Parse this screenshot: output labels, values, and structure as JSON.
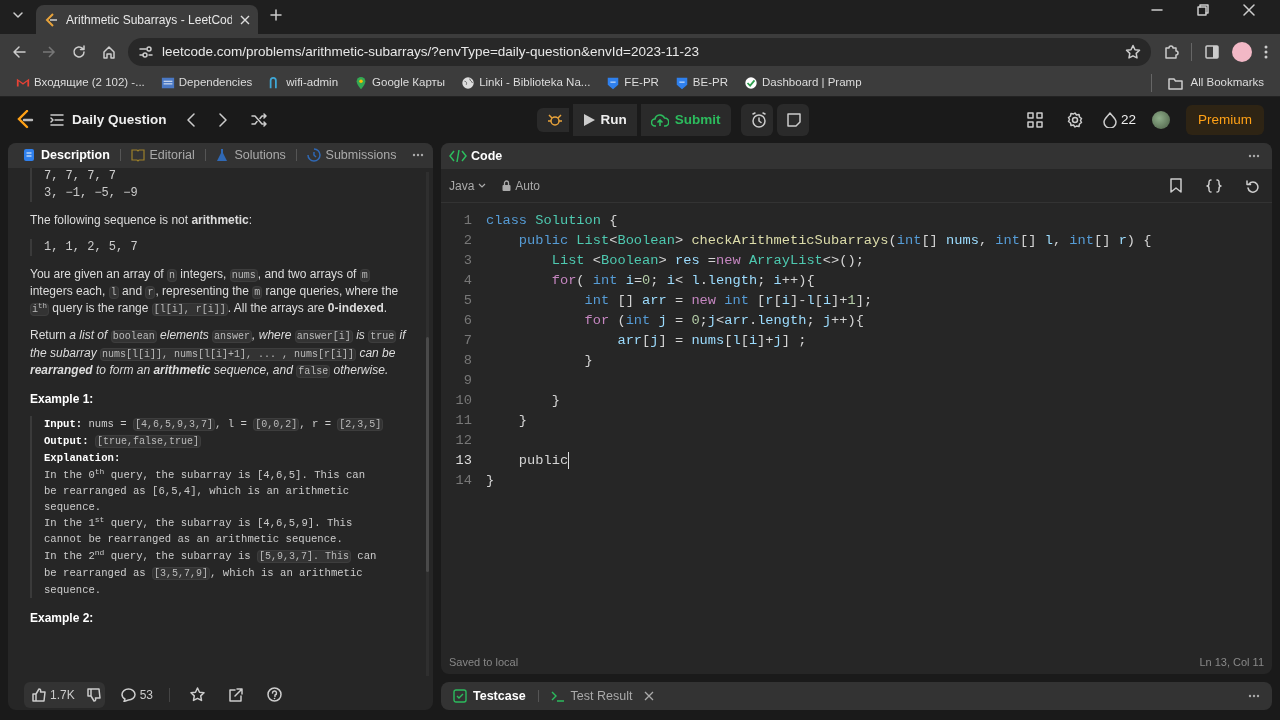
{
  "browser": {
    "tab_title": "Arithmetic Subarrays - LeetCod",
    "url": "leetcode.com/problems/arithmetic-subarrays/?envType=daily-question&envId=2023-11-23",
    "bookmarks": [
      {
        "label": "Входящие (2 102) -...",
        "kind": "mail"
      },
      {
        "label": "Dependencies",
        "kind": "page"
      },
      {
        "label": "wifi-admin",
        "kind": "fork"
      },
      {
        "label": "Google Карты",
        "kind": "pin"
      },
      {
        "label": "Linki - Biblioteka Na...",
        "kind": "globe"
      },
      {
        "label": "FE-PR",
        "kind": "shield"
      },
      {
        "label": "BE-PR",
        "kind": "shield"
      },
      {
        "label": "Dashboard | Pramp",
        "kind": "check"
      }
    ],
    "all_bookmarks": "All Bookmarks"
  },
  "nav": {
    "title": "Daily Question",
    "run": "Run",
    "submit": "Submit",
    "streak": "22",
    "premium": "Premium"
  },
  "tabs": [
    {
      "label": "Description",
      "kind": "doc",
      "selected": true
    },
    {
      "label": "Editorial",
      "kind": "book",
      "selected": false
    },
    {
      "label": "Solutions",
      "kind": "flask",
      "selected": false
    },
    {
      "label": "Submissions",
      "kind": "history",
      "selected": false
    }
  ],
  "description": [
    {
      "kind": "pre",
      "lines": [
        "7, 7, 7, 7",
        "3, −1, −5, −9"
      ]
    },
    {
      "kind": "para",
      "segments": [
        {
          "kind": "text",
          "text": "The following sequence is not **arithmetic**:"
        }
      ]
    },
    {
      "kind": "pre",
      "lines": [
        "1, 1, 2, 5, 7"
      ]
    },
    {
      "kind": "para",
      "segments": [
        {
          "kind": "text",
          "text": "You are given an array of "
        },
        {
          "kind": "code",
          "text": "n"
        },
        {
          "kind": "text",
          "text": " integers, "
        },
        {
          "kind": "code",
          "text": "nums"
        },
        {
          "kind": "text",
          "text": ", and two arrays of "
        },
        {
          "kind": "code",
          "text": "m"
        },
        {
          "kind": "text",
          "text": " integers each, "
        },
        {
          "kind": "code",
          "text": "l"
        },
        {
          "kind": "text",
          "text": " and "
        },
        {
          "kind": "code",
          "text": "r"
        },
        {
          "kind": "text",
          "text": ", representing the "
        },
        {
          "kind": "code",
          "text": "m"
        },
        {
          "kind": "text",
          "text": " range queries, where the "
        },
        {
          "kind": "code",
          "text": "i$^{th}$"
        },
        {
          "kind": "text",
          "text": " query is the range "
        },
        {
          "kind": "code",
          "text": "[l[i], r[i]]"
        },
        {
          "kind": "text",
          "text": ". All the arrays are **0-indexed**."
        }
      ]
    },
    {
      "kind": "para",
      "segments": [
        {
          "kind": "text",
          "text": "Return "
        },
        {
          "kind": "em",
          "text": "a list of "
        },
        {
          "kind": "code",
          "text": "boolean"
        },
        {
          "kind": "em",
          "text": " elements "
        },
        {
          "kind": "code",
          "text": "answer"
        },
        {
          "kind": "em",
          "text": ", where "
        },
        {
          "kind": "code",
          "text": "answer[i]"
        },
        {
          "kind": "em",
          "text": " is "
        },
        {
          "kind": "code",
          "text": "true"
        },
        {
          "kind": "em",
          "text": " if the subarray "
        },
        {
          "kind": "code",
          "text": "nums[l[i]], nums[l[i]+1], ... , nums[r[i]]"
        },
        {
          "kind": "em",
          "text": " can be **rearranged** to form an **arithmetic** sequence, and "
        },
        {
          "kind": "code",
          "text": "false"
        },
        {
          "kind": "em",
          "text": " otherwise."
        }
      ]
    },
    {
      "kind": "heading",
      "text": "Example 1:"
    },
    {
      "kind": "example",
      "lines": [
        [
          {
            "kind": "text",
            "text": "**Input:** nums = "
          },
          {
            "kind": "code",
            "text": "[4,6,5,9,3,7]"
          },
          {
            "kind": "text",
            "text": ", l = "
          },
          {
            "kind": "code",
            "text": "[0,0,2]"
          },
          {
            "kind": "text",
            "text": ", r = "
          },
          {
            "kind": "code",
            "text": "[2,3,5]"
          }
        ],
        [
          {
            "kind": "text",
            "text": "**Output:** "
          },
          {
            "kind": "code",
            "text": "[true,false,true]"
          }
        ],
        [
          {
            "kind": "text",
            "text": "**Explanation:**"
          }
        ],
        [
          {
            "kind": "text",
            "text": "In the 0$^{th}$ query, the subarray is [4,6,5]. This can"
          }
        ],
        [
          {
            "kind": "text",
            "text": "be rearranged as [6,5,4], which is an arithmetic"
          }
        ],
        [
          {
            "kind": "text",
            "text": "sequence."
          }
        ],
        [
          {
            "kind": "text",
            "text": "In the 1$^{st}$ query, the subarray is [4,6,5,9]. This"
          }
        ],
        [
          {
            "kind": "text",
            "text": "cannot be rearranged as an arithmetic sequence."
          }
        ],
        [
          {
            "kind": "text",
            "text": "In the 2$^{nd}$ query, the subarray is "
          },
          {
            "kind": "code",
            "text": "[5,9,3,7]. This"
          },
          {
            "kind": "text",
            "text": " can"
          }
        ],
        [
          {
            "kind": "text",
            "text": "be rearranged as "
          },
          {
            "kind": "code",
            "text": "[3,5,7,9]"
          },
          {
            "kind": "text",
            "text": ", which is an arithmetic"
          }
        ],
        [
          {
            "kind": "text",
            "text": "sequence."
          }
        ]
      ]
    },
    {
      "kind": "heading",
      "text": "Example 2:"
    }
  ],
  "footer": {
    "likes": "1.7K",
    "comments": "53"
  },
  "editor": {
    "title": "Code",
    "language": "Java",
    "mode": "Auto",
    "status": "Saved to local",
    "cursor": "Ln 13, Col 11",
    "lines": [
      {
        "no": "1",
        "current": false,
        "tokens": [
          {
            "text": "class ",
            "kind": "kw"
          },
          {
            "text": "Solution",
            "kind": "type"
          },
          {
            "text": " {",
            "kind": "plain"
          }
        ]
      },
      {
        "no": "2",
        "current": false,
        "tokens": [
          {
            "text": "    public ",
            "kind": "kw"
          },
          {
            "text": "List",
            "kind": "type"
          },
          {
            "text": "<",
            "kind": "plain"
          },
          {
            "text": "Boolean",
            "kind": "type"
          },
          {
            "text": "> ",
            "kind": "plain"
          },
          {
            "text": "checkArithmeticSubarrays",
            "kind": "fn"
          },
          {
            "text": "(",
            "kind": "plain"
          },
          {
            "text": "int",
            "kind": "kw"
          },
          {
            "text": "[] ",
            "kind": "plain"
          },
          {
            "text": "nums",
            "kind": "var"
          },
          {
            "text": ", ",
            "kind": "plain"
          },
          {
            "text": "int",
            "kind": "kw"
          },
          {
            "text": "[] ",
            "kind": "plain"
          },
          {
            "text": "l",
            "kind": "var"
          },
          {
            "text": ", ",
            "kind": "plain"
          },
          {
            "text": "int",
            "kind": "kw"
          },
          {
            "text": "[] ",
            "kind": "plain"
          },
          {
            "text": "r",
            "kind": "var"
          },
          {
            "text": ") {",
            "kind": "plain"
          }
        ]
      },
      {
        "no": "3",
        "current": false,
        "tokens": [
          {
            "text": "        List",
            "kind": "type"
          },
          {
            "text": " <",
            "kind": "plain"
          },
          {
            "text": "Boolean",
            "kind": "type"
          },
          {
            "text": "> ",
            "kind": "plain"
          },
          {
            "text": "res",
            "kind": "var"
          },
          {
            "text": " =",
            "kind": "plain"
          },
          {
            "text": "new ",
            "kind": "ctrl"
          },
          {
            "text": "ArrayList",
            "kind": "type"
          },
          {
            "text": "<>();",
            "kind": "plain"
          }
        ]
      },
      {
        "no": "4",
        "current": false,
        "tokens": [
          {
            "text": "        for",
            "kind": "ctrl"
          },
          {
            "text": "( ",
            "kind": "plain"
          },
          {
            "text": "int ",
            "kind": "kw"
          },
          {
            "text": "i",
            "kind": "var"
          },
          {
            "text": "=",
            "kind": "plain"
          },
          {
            "text": "0",
            "kind": "num"
          },
          {
            "text": "; ",
            "kind": "plain"
          },
          {
            "text": "i",
            "kind": "var"
          },
          {
            "text": "< ",
            "kind": "plain"
          },
          {
            "text": "l",
            "kind": "var"
          },
          {
            "text": ".",
            "kind": "plain"
          },
          {
            "text": "length",
            "kind": "var"
          },
          {
            "text": "; ",
            "kind": "plain"
          },
          {
            "text": "i",
            "kind": "var"
          },
          {
            "text": "++){",
            "kind": "plain"
          }
        ]
      },
      {
        "no": "5",
        "current": false,
        "tokens": [
          {
            "text": "            int",
            "kind": "kw"
          },
          {
            "text": " [] ",
            "kind": "plain"
          },
          {
            "text": "arr",
            "kind": "var"
          },
          {
            "text": " = ",
            "kind": "plain"
          },
          {
            "text": "new ",
            "kind": "ctrl"
          },
          {
            "text": "int",
            "kind": "kw"
          },
          {
            "text": " [",
            "kind": "plain"
          },
          {
            "text": "r",
            "kind": "var"
          },
          {
            "text": "[",
            "kind": "plain"
          },
          {
            "text": "i",
            "kind": "var"
          },
          {
            "text": "]-",
            "kind": "plain"
          },
          {
            "text": "l",
            "kind": "var"
          },
          {
            "text": "[",
            "kind": "plain"
          },
          {
            "text": "i",
            "kind": "var"
          },
          {
            "text": "]+",
            "kind": "plain"
          },
          {
            "text": "1",
            "kind": "num"
          },
          {
            "text": "];",
            "kind": "plain"
          }
        ]
      },
      {
        "no": "6",
        "current": false,
        "tokens": [
          {
            "text": "            for",
            "kind": "ctrl"
          },
          {
            "text": " (",
            "kind": "plain"
          },
          {
            "text": "int ",
            "kind": "kw"
          },
          {
            "text": "j",
            "kind": "var"
          },
          {
            "text": " = ",
            "kind": "plain"
          },
          {
            "text": "0",
            "kind": "num"
          },
          {
            "text": ";",
            "kind": "plain"
          },
          {
            "text": "j",
            "kind": "var"
          },
          {
            "text": "<",
            "kind": "plain"
          },
          {
            "text": "arr",
            "kind": "var"
          },
          {
            "text": ".",
            "kind": "plain"
          },
          {
            "text": "length",
            "kind": "var"
          },
          {
            "text": "; ",
            "kind": "plain"
          },
          {
            "text": "j",
            "kind": "var"
          },
          {
            "text": "++){",
            "kind": "plain"
          }
        ]
      },
      {
        "no": "7",
        "current": false,
        "tokens": [
          {
            "text": "                arr",
            "kind": "var"
          },
          {
            "text": "[",
            "kind": "plain"
          },
          {
            "text": "j",
            "kind": "var"
          },
          {
            "text": "] = ",
            "kind": "plain"
          },
          {
            "text": "nums",
            "kind": "var"
          },
          {
            "text": "[",
            "kind": "plain"
          },
          {
            "text": "l",
            "kind": "var"
          },
          {
            "text": "[",
            "kind": "plain"
          },
          {
            "text": "i",
            "kind": "var"
          },
          {
            "text": "]+",
            "kind": "plain"
          },
          {
            "text": "j",
            "kind": "var"
          },
          {
            "text": "] ;",
            "kind": "plain"
          }
        ]
      },
      {
        "no": "8",
        "current": false,
        "tokens": [
          {
            "text": "            }",
            "kind": "plain"
          }
        ]
      },
      {
        "no": "9",
        "current": false
      },
      {
        "no": "10",
        "current": false,
        "tokens": [
          {
            "text": "        }",
            "kind": "plain"
          }
        ]
      },
      {
        "no": "11",
        "current": false,
        "tokens": [
          {
            "text": "    }",
            "kind": "plain"
          }
        ]
      },
      {
        "no": "12",
        "current": false
      },
      {
        "no": "13",
        "current": true,
        "tokens": [
          {
            "text": "    public",
            "kind": "plain"
          }
        ]
      },
      {
        "no": "14",
        "current": false,
        "tokens": [
          {
            "text": "}",
            "kind": "plain"
          }
        ]
      }
    ]
  },
  "bottom_tabs": [
    {
      "label": "Testcase",
      "kind": "check",
      "selected": true
    },
    {
      "label": "Test Result",
      "kind": "terminal",
      "selected": false
    }
  ]
}
